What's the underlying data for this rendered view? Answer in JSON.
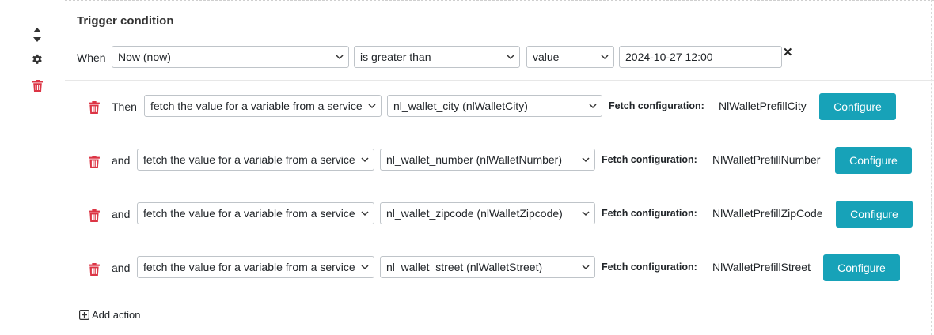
{
  "title": "Trigger condition",
  "condition": {
    "when_label": "When",
    "field": "Now (now)",
    "operator": "is greater than",
    "type": "value",
    "value": "2024-10-27 12:00",
    "remove_symbol": "✕"
  },
  "actions": [
    {
      "connector": "Then",
      "action": "fetch the value for a variable from a service",
      "variable": "nl_wallet_city (nlWalletCity)",
      "fetch_label": "Fetch configuration:",
      "fetch_value": "NlWalletPrefillCity",
      "button": "Configure"
    },
    {
      "connector": "and",
      "action": "fetch the value for a variable from a service",
      "variable": "nl_wallet_number (nlWalletNumber)",
      "fetch_label": "Fetch configuration:",
      "fetch_value": "NlWalletPrefillNumber",
      "button": "Configure"
    },
    {
      "connector": "and",
      "action": "fetch the value for a variable from a service",
      "variable": "nl_wallet_zipcode (nlWalletZipcode)",
      "fetch_label": "Fetch configuration:",
      "fetch_value": "NlWalletPrefillZipCode",
      "button": "Configure"
    },
    {
      "connector": "and",
      "action": "fetch the value for a variable from a service",
      "variable": "nl_wallet_street (nlWalletStreet)",
      "fetch_label": "Fetch configuration:",
      "fetch_value": "NlWalletPrefillStreet",
      "button": "Configure"
    }
  ],
  "add_action": "Add action",
  "colors": {
    "accent": "#17a2b8",
    "danger": "#dc3545"
  },
  "icons": {
    "sort": "sort-icon",
    "settings": "gear-icon",
    "delete": "trash-icon",
    "add": "plus-square-icon",
    "dropdown": "chevron-down-icon"
  }
}
